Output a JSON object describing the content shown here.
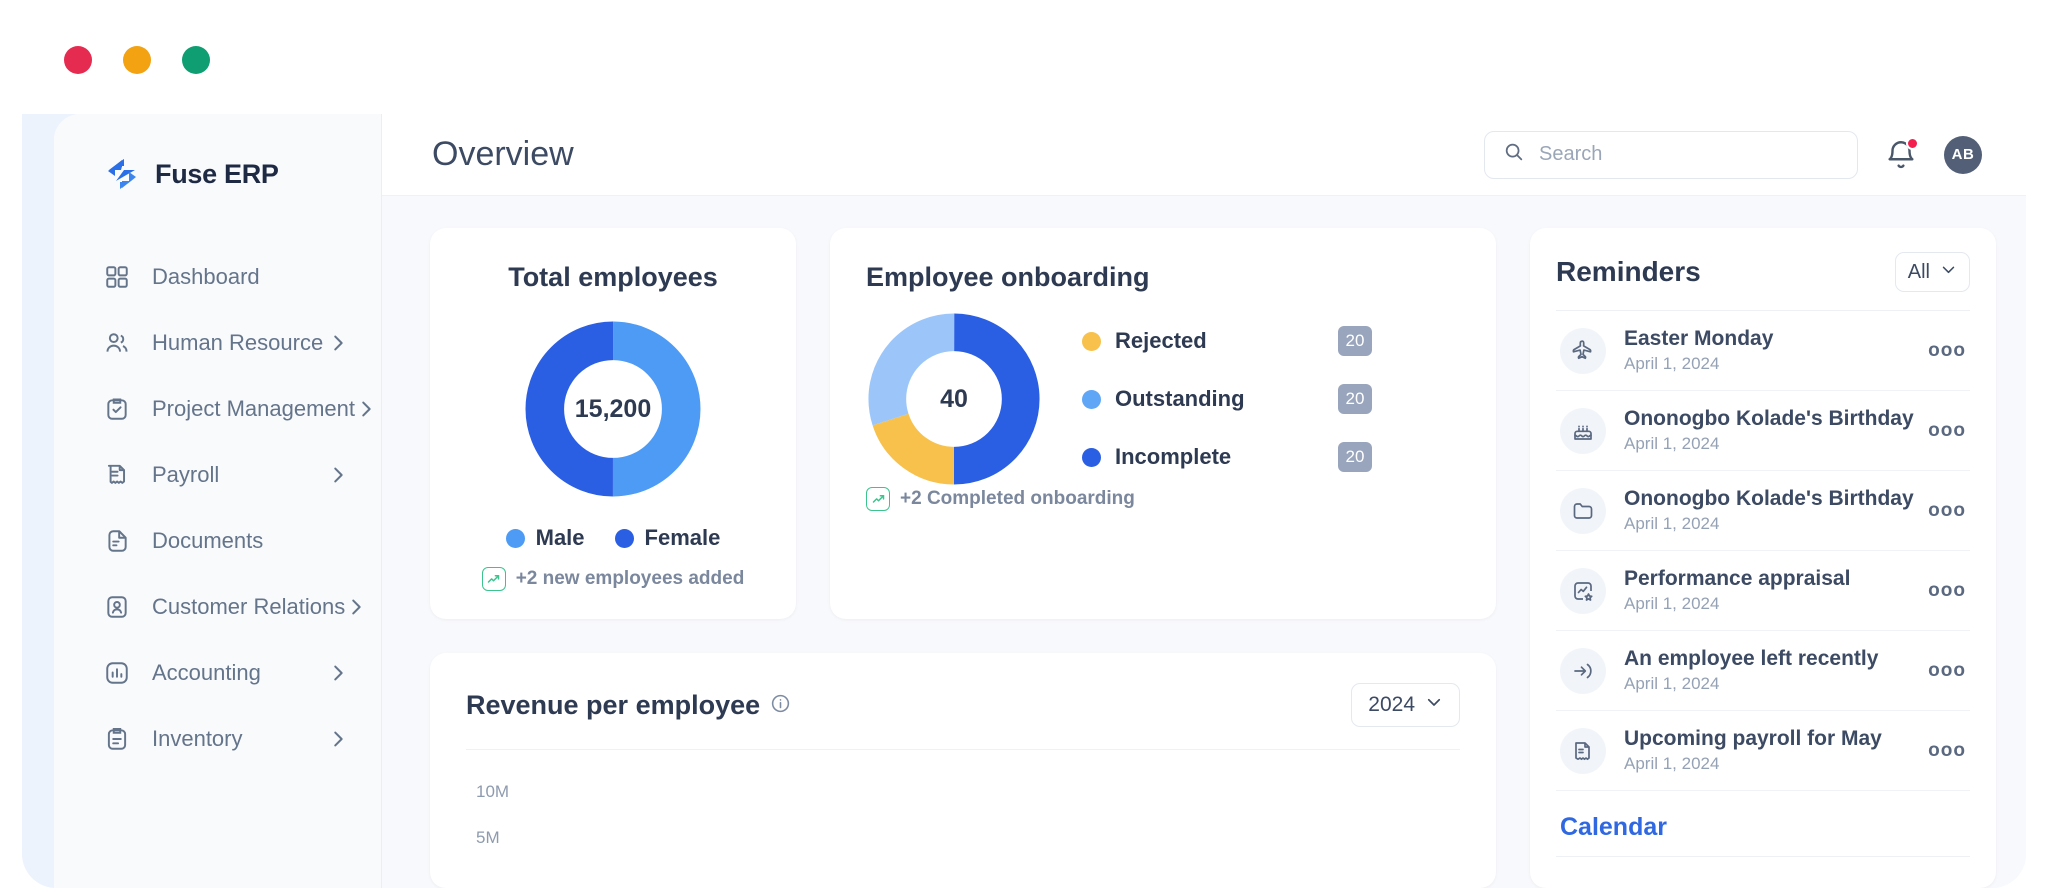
{
  "window": {
    "lights": [
      "close",
      "minimize",
      "maximize"
    ]
  },
  "sidebar": {
    "brand": "Fuse ERP",
    "items": [
      {
        "label": "Dashboard",
        "icon": "grid-icon",
        "chevron": false
      },
      {
        "label": "Human Resource",
        "icon": "users-icon",
        "chevron": true
      },
      {
        "label": "Project Management",
        "icon": "clipboard-check-icon",
        "chevron": true
      },
      {
        "label": "Payroll",
        "icon": "receipt-icon",
        "chevron": true
      },
      {
        "label": "Documents",
        "icon": "document-icon",
        "chevron": false
      },
      {
        "label": "Customer Relations",
        "icon": "contact-card-icon",
        "chevron": true
      },
      {
        "label": "Accounting",
        "icon": "bar-chart-icon",
        "chevron": true
      },
      {
        "label": "Inventory",
        "icon": "clipboard-list-icon",
        "chevron": true
      }
    ]
  },
  "header": {
    "title": "Overview",
    "search_placeholder": "Search",
    "search_value": "",
    "avatar_initials": "AB",
    "notification_badge": true
  },
  "total_employees": {
    "title": "Total employees",
    "center_value": "15,200",
    "note": "+2 new employees added",
    "legend": [
      {
        "label": "Male",
        "color": "#4E9BF5"
      },
      {
        "label": "Female",
        "color": "#2B5FE3"
      }
    ]
  },
  "onboarding": {
    "title": "Employee onboarding",
    "center_value": "40",
    "note": "+2 Completed onboarding",
    "legend": [
      {
        "label": "Rejected",
        "value": "20",
        "color": "#F7C14B"
      },
      {
        "label": "Outstanding",
        "value": "20",
        "color": "#5FA6F7"
      },
      {
        "label": "Incomplete",
        "value": "20",
        "color": "#2B5FE3"
      }
    ]
  },
  "revenue": {
    "title": "Revenue per employee",
    "info_icon": "info-icon",
    "year_selected": "2024",
    "yticks": [
      "10M",
      "5M"
    ]
  },
  "reminders": {
    "title": "Reminders",
    "filter_label": "All",
    "items": [
      {
        "name": "Easter Monday",
        "date": "April 1, 2024",
        "icon": "airplane-icon"
      },
      {
        "name": "Ononogbo Kolade's Birthday",
        "date": "April 1, 2024",
        "icon": "cake-icon"
      },
      {
        "name": "Ononogbo Kolade's Birthday",
        "date": "April 1, 2024",
        "icon": "folder-icon"
      },
      {
        "name": "Performance appraisal",
        "date": "April 1, 2024",
        "icon": "chart-star-icon"
      },
      {
        "name": "An employee left recently",
        "date": "April 1, 2024",
        "icon": "logout-icon"
      },
      {
        "name": "Upcoming payroll for May",
        "date": "April 1, 2024",
        "icon": "receipt-icon"
      }
    ],
    "more_glyph": "ooo",
    "calendar_title": "Calendar"
  },
  "chart_data": [
    {
      "type": "pie",
      "title": "Total employees",
      "center_label": "15,200",
      "categories": [
        "Male",
        "Female"
      ],
      "values": [
        50,
        50
      ],
      "colors": [
        "#4E9BF5",
        "#2B5FE3"
      ],
      "legend_position": "bottom"
    },
    {
      "type": "pie",
      "title": "Employee onboarding",
      "center_label": "40",
      "categories": [
        "Incomplete",
        "Outstanding",
        "Rejected"
      ],
      "values": [
        50,
        30,
        20
      ],
      "colors": [
        "#2B5FE3",
        "#9CC6F9",
        "#F7C14B"
      ],
      "legend_position": "right"
    },
    {
      "type": "bar",
      "title": "Revenue per employee",
      "xlabel": "",
      "ylabel": "",
      "categories": [],
      "values": [],
      "ytick_labels": [
        "10M",
        "5M"
      ],
      "ylim": [
        0,
        10
      ],
      "grid": false
    }
  ]
}
